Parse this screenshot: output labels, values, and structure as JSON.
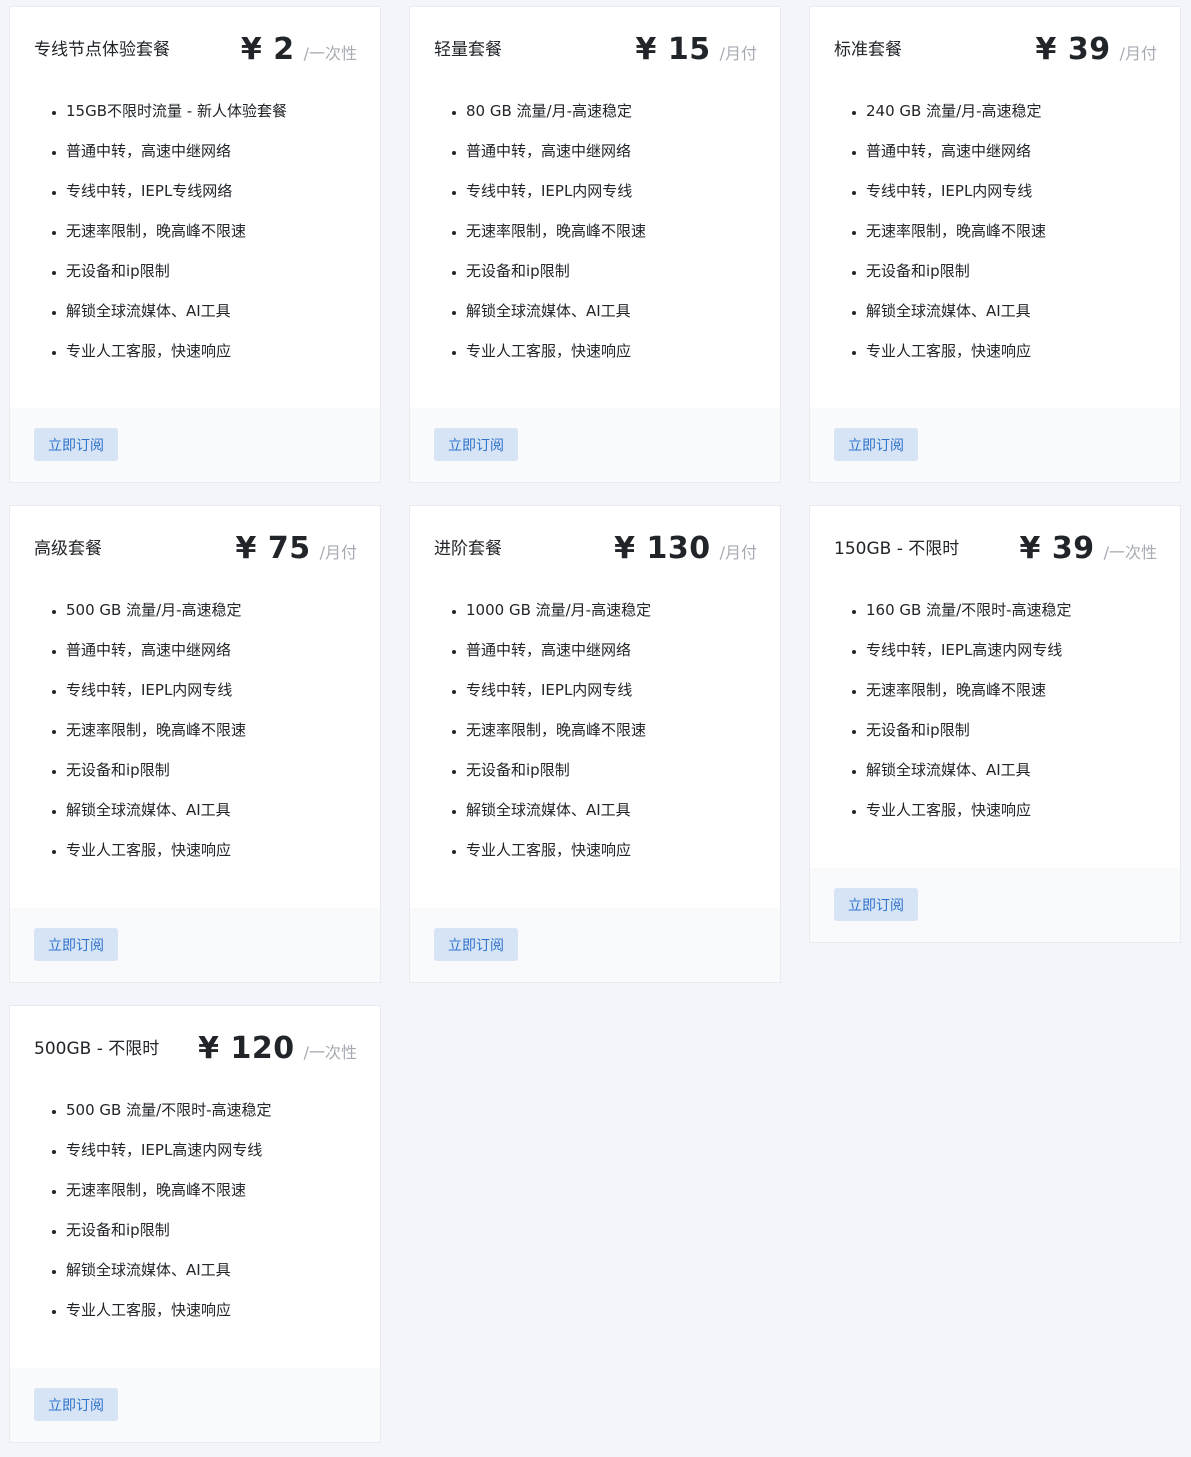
{
  "plans": [
    {
      "name": "专线节点体验套餐",
      "price": "¥ 2",
      "period": "/一次性",
      "features": [
        "15GB不限时流量 - 新人体验套餐",
        "普通中转，高速中继网络",
        "专线中转，IEPL专线网络",
        "无速率限制，晚高峰不限速",
        "无设备和ip限制",
        "解锁全球流媒体、AI工具",
        "专业人工客服，快速响应"
      ],
      "button": "立即订阅"
    },
    {
      "name": "轻量套餐",
      "price": "¥ 15",
      "period": "/月付",
      "features": [
        "80 GB 流量/月-高速稳定",
        "普通中转，高速中继网络",
        "专线中转，IEPL内网专线",
        "无速率限制，晚高峰不限速",
        "无设备和ip限制",
        "解锁全球流媒体、AI工具",
        "专业人工客服，快速响应"
      ],
      "button": "立即订阅"
    },
    {
      "name": "标准套餐",
      "price": "¥ 39",
      "period": "/月付",
      "features": [
        "240 GB 流量/月-高速稳定",
        "普通中转，高速中继网络",
        "专线中转，IEPL内网专线",
        "无速率限制，晚高峰不限速",
        "无设备和ip限制",
        "解锁全球流媒体、AI工具",
        "专业人工客服，快速响应"
      ],
      "button": "立即订阅"
    },
    {
      "name": "高级套餐",
      "price": "¥ 75",
      "period": "/月付",
      "features": [
        "500 GB 流量/月-高速稳定",
        "普通中转，高速中继网络",
        "专线中转，IEPL内网专线",
        "无速率限制，晚高峰不限速",
        "无设备和ip限制",
        "解锁全球流媒体、AI工具",
        "专业人工客服，快速响应"
      ],
      "button": "立即订阅"
    },
    {
      "name": "进阶套餐",
      "price": "¥ 130",
      "period": "/月付",
      "features": [
        "1000 GB 流量/月-高速稳定",
        "普通中转，高速中继网络",
        "专线中转，IEPL内网专线",
        "无速率限制，晚高峰不限速",
        "无设备和ip限制",
        "解锁全球流媒体、AI工具",
        "专业人工客服，快速响应"
      ],
      "button": "立即订阅"
    },
    {
      "name": "150GB - 不限时",
      "price": "¥ 39",
      "period": "/一次性",
      "features": [
        "160 GB 流量/不限时-高速稳定",
        "专线中转，IEPL高速内网专线",
        "无速率限制，晚高峰不限速",
        "无设备和ip限制",
        "解锁全球流媒体、AI工具",
        "专业人工客服，快速响应"
      ],
      "button": "立即订阅"
    },
    {
      "name": "500GB - 不限时",
      "price": "¥ 120",
      "period": "/一次性",
      "features": [
        "500 GB 流量/不限时-高速稳定",
        "专线中转，IEPL高速内网专线",
        "无速率限制，晚高峰不限速",
        "无设备和ip限制",
        "解锁全球流媒体、AI工具",
        "专业人工客服，快速响应"
      ],
      "button": "立即订阅"
    }
  ],
  "colors": {
    "page_background": "#f4f5fb",
    "card_background": "#ffffff",
    "footer_background": "#f9fafc",
    "button_background": "#d7e4f6",
    "button_text": "#2d72cc",
    "period_text": "#a7abb3"
  }
}
